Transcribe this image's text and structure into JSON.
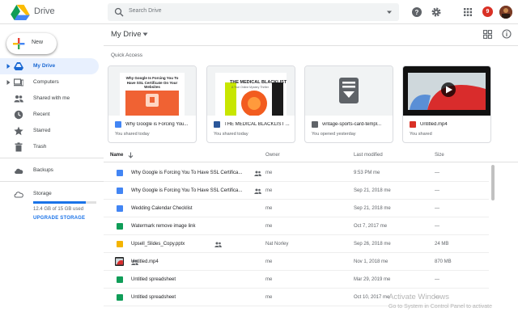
{
  "app": {
    "name": "Drive"
  },
  "search": {
    "placeholder": "Search Drive"
  },
  "header": {
    "notification_count": "9"
  },
  "sidebar": {
    "new_label": "New",
    "items": [
      {
        "label": "My Drive",
        "icon": "drive-icon",
        "active": true
      },
      {
        "label": "Computers",
        "icon": "computer-icon"
      },
      {
        "label": "Shared with me",
        "icon": "people-icon"
      },
      {
        "label": "Recent",
        "icon": "clock-icon"
      },
      {
        "label": "Starred",
        "icon": "star-icon"
      },
      {
        "label": "Trash",
        "icon": "trash-icon"
      },
      {
        "label": "Backups",
        "icon": "cloud-icon"
      },
      {
        "label": "Storage",
        "icon": "cloud-outline-icon"
      }
    ],
    "storage_text": "12.4 GB of 15 GB used",
    "storage_fraction": 0.83,
    "upgrade": "UPGRADE STORAGE"
  },
  "main": {
    "title": "My Drive",
    "quick_access": "Quick Access",
    "cards": [
      {
        "name": "Why Google is Forcing You...",
        "sub": "You shared today",
        "type": "doc",
        "thumb_title": "Why Google Is Forcing You To Have SSL Certificate On Your Websites"
      },
      {
        "name": "THE MEDICAL BLACKLIST ...",
        "sub": "You shared today",
        "type": "word",
        "thumb_title": "THE MEDICAL BLACKLIST",
        "thumb_sub": "A True Online Mystery Thriller"
      },
      {
        "name": "vintage-sports-card-templ...",
        "sub": "You opened yesterday",
        "type": "archive"
      },
      {
        "name": "Untitled.mp4",
        "sub": "You shared",
        "type": "video"
      }
    ],
    "columns": {
      "name": "Name",
      "owner": "Owner",
      "modified": "Last modified",
      "size": "Size"
    },
    "rows": [
      {
        "name": "Why Google is Forcing You To Have SSL Certifica...",
        "type": "doc",
        "shared": true,
        "owner": "me",
        "modified": "9:53 PM",
        "modified_by": "me",
        "size": "—"
      },
      {
        "name": "Why Google is Forcing You To Have SSL Certifica...",
        "type": "doc",
        "shared": true,
        "owner": "me",
        "modified": "Sep 21, 2018",
        "modified_by": "me",
        "size": "—"
      },
      {
        "name": "Wedding Calendar Checklist",
        "type": "doc",
        "owner": "me",
        "modified": "Sep 21, 2018",
        "modified_by": "me",
        "size": "—"
      },
      {
        "name": "Watermark remove image link",
        "type": "sheet",
        "owner": "me",
        "modified": "Oct 7, 2017",
        "modified_by": "me",
        "size": "—"
      },
      {
        "name": "Upsell_Slides_Copy.pptx",
        "type": "slides",
        "shared": true,
        "owner": "Nat Norley",
        "modified": "Sep 26, 2018",
        "modified_by": "me",
        "size": "24 MB"
      },
      {
        "name": "Untitled.mp4",
        "type": "video",
        "shared": true,
        "owner": "me",
        "modified": "Nov 1, 2018",
        "modified_by": "me",
        "size": "870 MB"
      },
      {
        "name": "Untitled spreadsheet",
        "type": "sheet",
        "owner": "me",
        "modified": "Mar 29, 2019",
        "modified_by": "me",
        "size": "—"
      },
      {
        "name": "Untitled spreadsheet",
        "type": "sheet",
        "owner": "me",
        "modified": "Oct 10, 2017",
        "modified_by": "me",
        "size": "—"
      }
    ]
  },
  "watermark": {
    "line1": "Activate Windows",
    "line2": "Go to System in Control Panel to activate"
  },
  "colors": {
    "accent": "#1a73e8",
    "doc": "#4285f4",
    "sheet": "#0f9d58",
    "slides": "#f4b400",
    "word": "#2b579a",
    "archive": "#5f6368",
    "video": "#d93025"
  }
}
